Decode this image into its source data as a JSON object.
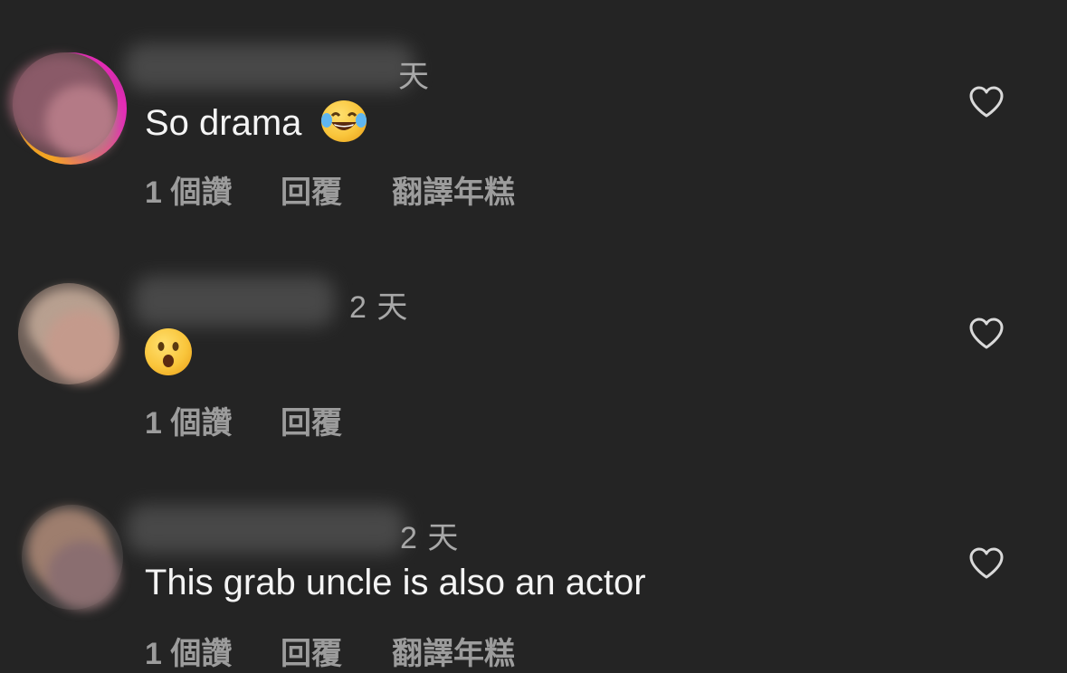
{
  "comments": [
    {
      "time": "天",
      "text": "So drama",
      "emoji_icon": "tears-of-joy-emoji",
      "likes": "1 個讚",
      "reply": "回覆",
      "translate": "翻譯年糕"
    },
    {
      "time": "2 天",
      "text": "",
      "emoji_icon": "hushed-face-emoji",
      "likes": "1 個讚",
      "reply": "回覆",
      "translate": ""
    },
    {
      "time": "2 天",
      "text": "This grab uncle is also an actor",
      "emoji_icon": "",
      "likes": "1 個讚",
      "reply": "回覆",
      "translate": "翻譯年糕"
    }
  ],
  "colors": {
    "background": "#242424",
    "primary_text": "#f4f4f4",
    "secondary_text": "#9c9c9c",
    "story_ring_pink": "#e62ab8",
    "story_ring_orange": "#f5a623"
  }
}
